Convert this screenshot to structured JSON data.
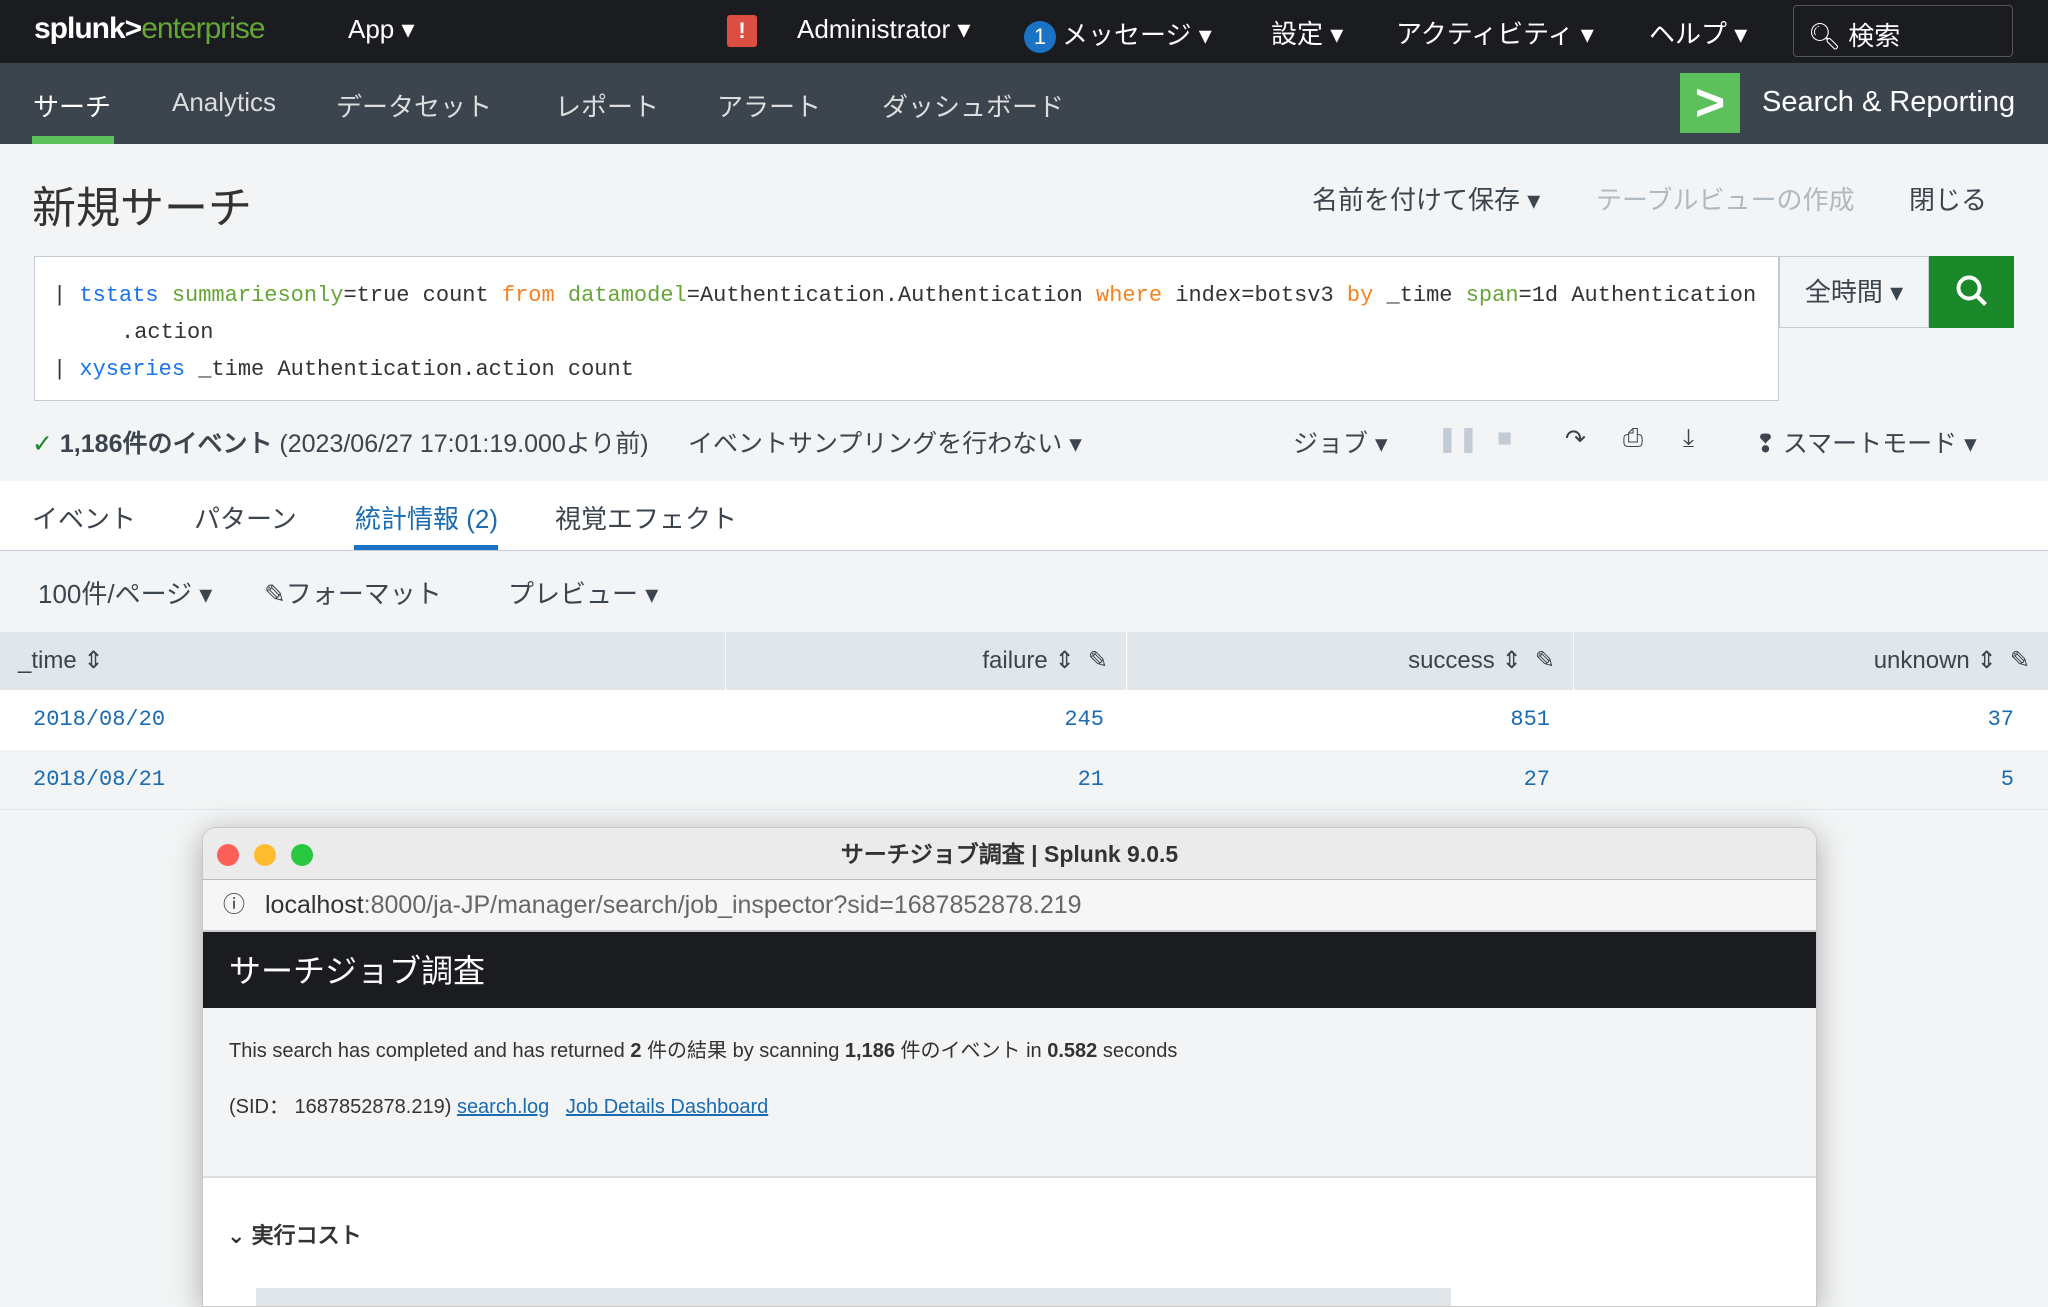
{
  "topbar": {
    "logo_a": "splunk>",
    "logo_b": "enterprise",
    "app": "App ▾",
    "alert": "!",
    "admin": "Administrator ▾",
    "msg_count": "1",
    "messages": "メッセージ ▾",
    "settings": "設定 ▾",
    "activity": "アクティビティ ▾",
    "help": "ヘルプ ▾",
    "search_placeholder": "検索"
  },
  "nav": {
    "items": [
      "サーチ",
      "Analytics",
      "データセット",
      "レポート",
      "アラート",
      "ダッシュボード"
    ],
    "app_name": "Search & Reporting"
  },
  "page": {
    "title": "新規サーチ",
    "save_as": "名前を付けて保存 ▾",
    "table_view": "テーブルビューの作成",
    "close": "閉じる"
  },
  "query": {
    "line1": [
      [
        "kw",
        "tstats"
      ],
      [
        "arg",
        " summariesonly"
      ],
      [
        "",
        "=true count "
      ],
      [
        "op",
        "from"
      ],
      [
        "arg",
        " datamodel"
      ],
      [
        "",
        "=Authentication.Authentication "
      ],
      [
        "op",
        "where"
      ],
      [
        "",
        " index=botsv3 "
      ],
      [
        "op",
        "by"
      ],
      [
        "",
        " _time "
      ],
      [
        "arg",
        "span"
      ],
      [
        "",
        "=1d Authentication"
      ]
    ],
    "line1b": ".action",
    "line2": [
      [
        "kw",
        "xyseries"
      ],
      [
        "",
        " _time Authentication.action count"
      ]
    ],
    "time_range": "全時間 ▾"
  },
  "status": {
    "events": "1,186件のイベント",
    "time": "(2023/06/27 17:01:19.000より前)",
    "sampling": "イベントサンプリングを行わない ▾",
    "job": "ジョブ ▾",
    "mode": "スマートモード ▾"
  },
  "tabs": [
    "イベント",
    "パターン",
    "統計情報 (2)",
    "視覚エフェクト"
  ],
  "toolbar": {
    "per_page": "100件/ページ ▾",
    "format": "フォーマット",
    "preview": "プレビュー ▾"
  },
  "table": {
    "columns": [
      "_time",
      "failure",
      "success",
      "unknown"
    ],
    "rows": [
      [
        "2018/08/20",
        "245",
        "851",
        "37"
      ],
      [
        "2018/08/21",
        "21",
        "27",
        "5"
      ]
    ]
  },
  "inspector": {
    "window_title": "サーチジョブ調査 | Splunk 9.0.5",
    "url_host": "localhost",
    "url_rest": ":8000/ja-JP/manager/search/job_inspector?sid=1687852878.219",
    "header": "サーチジョブ調査",
    "s1": "This search has completed and has returned ",
    "n1": "2",
    "s2": " 件の結果 by scanning ",
    "n2": "1,186",
    "s3": " 件のイベント in ",
    "n3": "0.582",
    "s4": " seconds",
    "sid": "(SID： 1687852878.219)",
    "link1": "search.log",
    "link2": "Job Details Dashboard",
    "section": "実行コスト"
  }
}
